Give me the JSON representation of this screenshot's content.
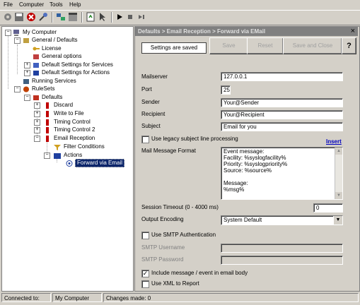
{
  "menu": {
    "file": "File",
    "computer": "Computer",
    "tools": "Tools",
    "help": "Help"
  },
  "toolbar": {
    "icons": [
      "gear-icon",
      "save-icon",
      "stop-icon",
      "wrench-icon",
      "network-icon",
      "window-icon",
      "refresh-icon",
      "pointer-icon",
      "play-icon",
      "stop-square-icon",
      "skip-icon"
    ]
  },
  "tree": {
    "root": "My Computer",
    "general": "General / Defaults",
    "license": "License",
    "general_options": "General options",
    "default_services": "Default Settings for Services",
    "default_actions": "Default Settings for Actions",
    "running_services": "Running Services",
    "rulesets": "RuleSets",
    "defaults": "Defaults",
    "discard": "Discard",
    "write_file": "Write to File",
    "timing_control": "Timing Control",
    "timing_control2": "Timing Control 2",
    "email_reception": "Email Reception",
    "filter_conditions": "Filter Conditions",
    "actions": "Actions",
    "forward_email": "Forward via Email"
  },
  "panel": {
    "breadcrumb": "Defaults > Email Reception > Forward via EMail",
    "status": "Settings are saved",
    "save": "Save",
    "reset": "Reset",
    "save_close": "Save and Close",
    "help": "?",
    "close": "×"
  },
  "form": {
    "mailserver_label": "Mailserver",
    "mailserver": "127.0.0.1",
    "port_label": "Port",
    "port": "25",
    "sender_label": "Sender",
    "sender": "Your@Sender",
    "recipient_label": "Recipient",
    "recipient": "Your@Recipient",
    "subject_label": "Subject",
    "subject": "Email for you",
    "legacy_label": "Use legacy subject line processing",
    "insert": "Insert",
    "format_label": "Mail Message Format",
    "format_lines": [
      "Event message:",
      "Facility: %syslogfacility%",
      "Priority: %syslogpriority%",
      "Source: %source%",
      "",
      "Message:",
      "%msg%"
    ],
    "timeout_label": "Session Timeout (0 - 4000 ms)",
    "timeout": "0",
    "encoding_label": "Output Encoding",
    "encoding": "System Default",
    "smtp_auth_label": "Use SMTP Authentication",
    "smtp_user_label": "SMTP Username",
    "smtp_pass_label": "SMTP Password",
    "include_label": "Include message / event in email body",
    "xml_label": "Use XML to Report"
  },
  "status": {
    "connected_label": "Connected to:",
    "computer": "My Computer",
    "changes": "Changes made: 0"
  },
  "colors": {
    "title_bg": "#808080",
    "selected": "#0a246a",
    "accent_link": "#0000c0"
  }
}
